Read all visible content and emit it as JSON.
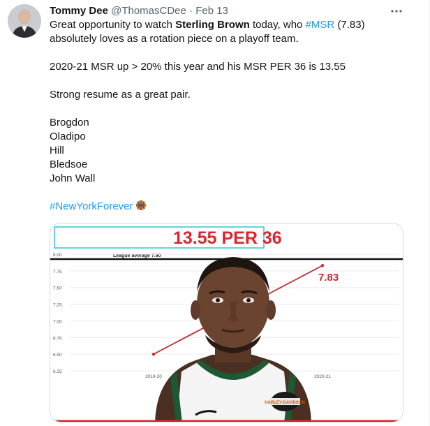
{
  "tweet": {
    "author_name": "Tommy Dee",
    "handle": "@ThomasCDee",
    "separator": "·",
    "date": "Feb 13",
    "text": {
      "l1_a": "Great opportunity to watch ",
      "l1_bold": "Sterling Brown",
      "l1_b": " today, who ",
      "l1_hash": "#MSR",
      "l1_c": " (7.83)",
      "l2": "absolutely loves as a rotation piece on a playoff team.",
      "l3": "2020-21 MSR up > 20% this year and his MSR PER 36 is 13.55",
      "l4": "Strong resume as a great pair.",
      "names": [
        "Brogdon",
        "Oladipo",
        "Hill",
        "Bledsoe",
        "John Wall"
      ],
      "hashtag2": "#NewYorkForever"
    }
  },
  "media": {
    "headline": "13.55 PER 36",
    "league_avg_label": "League average 7.90",
    "value_label": "7.83",
    "logo_text": "HARLEY-DAVIDSON",
    "colors": {
      "headline_red": "#d9262f",
      "line_red": "#c62a31",
      "cyan_box": "#34c3d6",
      "jersey": "#ffffff"
    }
  },
  "chart_data": {
    "type": "line",
    "x": [
      "2019-20",
      "2020-21"
    ],
    "series": [
      {
        "values": [
          6.5,
          7.83
        ]
      }
    ],
    "ytick_labels": [
      "8.00",
      "7.75",
      "7.50",
      "7.25",
      "7.00",
      "6.75",
      "6.50",
      "6.25"
    ],
    "ylim": [
      6.25,
      8.0
    ],
    "reference_line": {
      "label": "League average 7.90",
      "value": 7.9
    },
    "title": "13.55 PER 36",
    "data_labels": [
      "7.83"
    ]
  }
}
